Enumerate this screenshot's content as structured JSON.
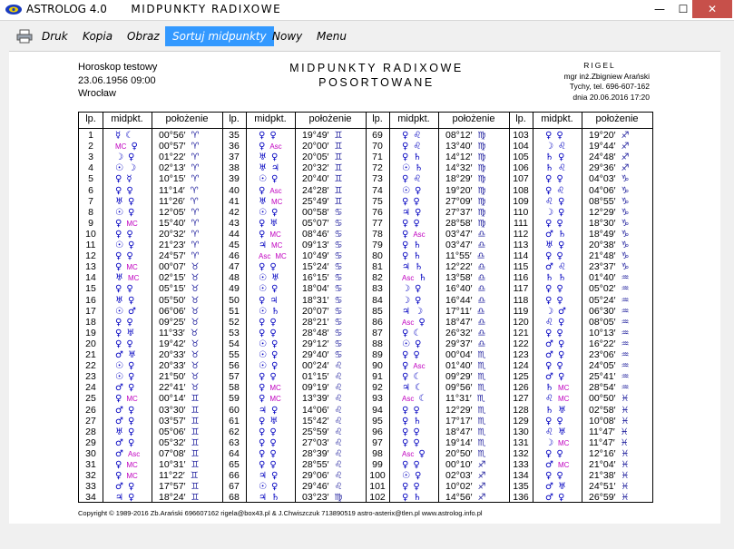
{
  "window": {
    "app_name": "ASTROLOG 4.0",
    "doc_title": "MIDPUNKTY RADIXOWE",
    "min": "—",
    "max": "☐",
    "close": "✕"
  },
  "menu": {
    "items": [
      "Druk",
      "Kopia",
      "Obraz",
      "Sortuj midpunkty",
      "Nowy",
      "Menu"
    ],
    "active": "Sortuj midpunkty"
  },
  "header": {
    "left": [
      "Horoskop testowy",
      "23.06.1956  09:00",
      "Wrocław"
    ],
    "center": [
      "MIDPUNKTY RADIXOWE",
      "POSORTOWANE"
    ],
    "right_company": "RIGEL",
    "right_lines": [
      "mgr inż.Zbigniew Arański",
      "Tychy, tel. 696-607-162",
      "dnia 20.06.2016 17:20"
    ]
  },
  "table": {
    "headers": [
      "lp.",
      "midpkt.",
      "położenie"
    ],
    "row_count": 34,
    "rows": [
      {
        "n": 1,
        "a": "☿",
        "b": "☾",
        "d": "00°56′",
        "s": "♈"
      },
      {
        "n": 2,
        "a": "MC",
        "b": "♀",
        "d": "00°57′",
        "s": "♈"
      },
      {
        "n": 3,
        "a": "☽",
        "b": "♀",
        "d": "01°22′",
        "s": "♈"
      },
      {
        "n": 4,
        "a": "☉",
        "b": "☽",
        "d": "02°13′",
        "s": "♈"
      },
      {
        "n": 5,
        "a": "♀",
        "b": "☿",
        "d": "10°15′",
        "s": "♈"
      },
      {
        "n": 6,
        "a": "♀",
        "b": "♀",
        "d": "11°14′",
        "s": "♈"
      },
      {
        "n": 7,
        "a": "♅",
        "b": "♀",
        "d": "11°26′",
        "s": "♈"
      },
      {
        "n": 8,
        "a": "☉",
        "b": "♀",
        "d": "12°05′",
        "s": "♈"
      },
      {
        "n": 9,
        "a": "♀",
        "b": "MC",
        "d": "15°40′",
        "s": "♈"
      },
      {
        "n": 10,
        "a": "♀",
        "b": "♀",
        "d": "20°32′",
        "s": "♈"
      },
      {
        "n": 11,
        "a": "☉",
        "b": "♀",
        "d": "21°23′",
        "s": "♈"
      },
      {
        "n": 12,
        "a": "♀",
        "b": "♀",
        "d": "24°57′",
        "s": "♈"
      },
      {
        "n": 13,
        "a": "♀",
        "b": "MC",
        "d": "00°07′",
        "s": "♉"
      },
      {
        "n": 14,
        "a": "♅",
        "b": "MC",
        "d": "02°15′",
        "s": "♉"
      },
      {
        "n": 15,
        "a": "♀",
        "b": "♀",
        "d": "05°15′",
        "s": "♉"
      },
      {
        "n": 16,
        "a": "♅",
        "b": "♀",
        "d": "05°50′",
        "s": "♉"
      },
      {
        "n": 17,
        "a": "☉",
        "b": "♂",
        "d": "06°06′",
        "s": "♉"
      },
      {
        "n": 18,
        "a": "♀",
        "b": "♀",
        "d": "09°25′",
        "s": "♉"
      },
      {
        "n": 19,
        "a": "♀",
        "b": "♅",
        "d": "11°33′",
        "s": "♉"
      },
      {
        "n": 20,
        "a": "♀",
        "b": "♀",
        "d": "19°42′",
        "s": "♉"
      },
      {
        "n": 21,
        "a": "♂",
        "b": "♅",
        "d": "20°33′",
        "s": "♉"
      },
      {
        "n": 22,
        "a": "☉",
        "b": "♀",
        "d": "20°33′",
        "s": "♉"
      },
      {
        "n": 23,
        "a": "☉",
        "b": "♀",
        "d": "21°50′",
        "s": "♉"
      },
      {
        "n": 24,
        "a": "♂",
        "b": "♀",
        "d": "22°41′",
        "s": "♉"
      },
      {
        "n": 25,
        "a": "♀",
        "b": "MC",
        "d": "00°14′",
        "s": "♊"
      },
      {
        "n": 26,
        "a": "♂",
        "b": "♀",
        "d": "03°30′",
        "s": "♊"
      },
      {
        "n": 27,
        "a": "♂",
        "b": "♀",
        "d": "03°57′",
        "s": "♊"
      },
      {
        "n": 28,
        "a": "♅",
        "b": "♀",
        "d": "05°06′",
        "s": "♊"
      },
      {
        "n": 29,
        "a": "♂",
        "b": "♀",
        "d": "05°32′",
        "s": "♊"
      },
      {
        "n": 30,
        "a": "♂",
        "b": "Asc",
        "d": "07°08′",
        "s": "♊"
      },
      {
        "n": 31,
        "a": "♀",
        "b": "MC",
        "d": "10°31′",
        "s": "♊"
      },
      {
        "n": 32,
        "a": "♀",
        "b": "MC",
        "d": "11°22′",
        "s": "♊"
      },
      {
        "n": 33,
        "a": "♂",
        "b": "♀",
        "d": "17°57′",
        "s": "♊"
      },
      {
        "n": 34,
        "a": "♃",
        "b": "♀",
        "d": "18°24′",
        "s": "♊"
      },
      {
        "n": 35,
        "a": "♀",
        "b": "♀",
        "d": "19°49′",
        "s": "♊"
      },
      {
        "n": 36,
        "a": "♀",
        "b": "Asc",
        "d": "20°00′",
        "s": "♊"
      },
      {
        "n": 37,
        "a": "♅",
        "b": "♀",
        "d": "20°05′",
        "s": "♊"
      },
      {
        "n": 38,
        "a": "♅",
        "b": "♃",
        "d": "20°32′",
        "s": "♊"
      },
      {
        "n": 39,
        "a": "☉",
        "b": "♀",
        "d": "20°40′",
        "s": "♊"
      },
      {
        "n": 40,
        "a": "♀",
        "b": "Asc",
        "d": "24°28′",
        "s": "♊"
      },
      {
        "n": 41,
        "a": "♅",
        "b": "MC",
        "d": "25°49′",
        "s": "♊"
      },
      {
        "n": 42,
        "a": "☉",
        "b": "♀",
        "d": "00°58′",
        "s": "♋"
      },
      {
        "n": 43,
        "a": "♀",
        "b": "♅",
        "d": "05°07′",
        "s": "♋"
      },
      {
        "n": 44,
        "a": "♀",
        "b": "MC",
        "d": "08°46′",
        "s": "♋"
      },
      {
        "n": 45,
        "a": "♃",
        "b": "MC",
        "d": "09°13′",
        "s": "♋"
      },
      {
        "n": 46,
        "a": "Asc",
        "b": "MC",
        "d": "10°49′",
        "s": "♋"
      },
      {
        "n": 47,
        "a": "♀",
        "b": "♀",
        "d": "15°24′",
        "s": "♋"
      },
      {
        "n": 48,
        "a": "☉",
        "b": "♅",
        "d": "16°15′",
        "s": "♋"
      },
      {
        "n": 49,
        "a": "☉",
        "b": "♀",
        "d": "18°04′",
        "s": "♋"
      },
      {
        "n": 50,
        "a": "♀",
        "b": "♃",
        "d": "18°31′",
        "s": "♋"
      },
      {
        "n": 51,
        "a": "☉",
        "b": "♄",
        "d": "20°07′",
        "s": "♋"
      },
      {
        "n": 52,
        "a": "♀",
        "b": "♀",
        "d": "28°21′",
        "s": "♋"
      },
      {
        "n": 53,
        "a": "♀",
        "b": "♀",
        "d": "28°48′",
        "s": "♋"
      },
      {
        "n": 54,
        "a": "☉",
        "b": "♀",
        "d": "29°12′",
        "s": "♋"
      },
      {
        "n": 55,
        "a": "☉",
        "b": "♀",
        "d": "29°40′",
        "s": "♋"
      },
      {
        "n": 56,
        "a": "☉",
        "b": "♀",
        "d": "00°24′",
        "s": "♌"
      },
      {
        "n": 57,
        "a": "♀",
        "b": "♀",
        "d": "01°15′",
        "s": "♌"
      },
      {
        "n": 58,
        "a": "♀",
        "b": "MC",
        "d": "09°19′",
        "s": "♌"
      },
      {
        "n": 59,
        "a": "♀",
        "b": "MC",
        "d": "13°39′",
        "s": "♌"
      },
      {
        "n": 60,
        "a": "♃",
        "b": "♀",
        "d": "14°06′",
        "s": "♌"
      },
      {
        "n": 61,
        "a": "♀",
        "b": "♅",
        "d": "15°42′",
        "s": "♌"
      },
      {
        "n": 62,
        "a": "♀",
        "b": "♀",
        "d": "25°59′",
        "s": "♌"
      },
      {
        "n": 63,
        "a": "♀",
        "b": "♀",
        "d": "27°03′",
        "s": "♌"
      },
      {
        "n": 64,
        "a": "♀",
        "b": "♀",
        "d": "28°39′",
        "s": "♌"
      },
      {
        "n": 65,
        "a": "♀",
        "b": "♀",
        "d": "28°55′",
        "s": "♌"
      },
      {
        "n": 66,
        "a": "♃",
        "b": "♀",
        "d": "29°06′",
        "s": "♌"
      },
      {
        "n": 67,
        "a": "☉",
        "b": "♀",
        "d": "29°46′",
        "s": "♌"
      },
      {
        "n": 68,
        "a": "♃",
        "b": "♄",
        "d": "03°23′",
        "s": "♍"
      },
      {
        "n": 69,
        "a": "♀",
        "b": "♌",
        "d": "08°12′",
        "s": "♍"
      },
      {
        "n": 70,
        "a": "♀",
        "b": "♌",
        "d": "13°40′",
        "s": "♍"
      },
      {
        "n": 71,
        "a": "♀",
        "b": "♄",
        "d": "14°12′",
        "s": "♍"
      },
      {
        "n": 72,
        "a": "☉",
        "b": "♄",
        "d": "14°32′",
        "s": "♍"
      },
      {
        "n": 73,
        "a": "♀",
        "b": "♌",
        "d": "18°29′",
        "s": "♍"
      },
      {
        "n": 74,
        "a": "☉",
        "b": "♀",
        "d": "19°20′",
        "s": "♍"
      },
      {
        "n": 75,
        "a": "♀",
        "b": "♀",
        "d": "27°09′",
        "s": "♍"
      },
      {
        "n": 76,
        "a": "♃",
        "b": "♀",
        "d": "27°37′",
        "s": "♍"
      },
      {
        "n": 77,
        "a": "♀",
        "b": "♀",
        "d": "28°58′",
        "s": "♍"
      },
      {
        "n": 78,
        "a": "♀",
        "b": "Asc",
        "d": "03°47′",
        "s": "♎"
      },
      {
        "n": 79,
        "a": "♀",
        "b": "♄",
        "d": "03°47′",
        "s": "♎"
      },
      {
        "n": 80,
        "a": "♀",
        "b": "♄",
        "d": "11°55′",
        "s": "♎"
      },
      {
        "n": 81,
        "a": "♃",
        "b": "♄",
        "d": "12°22′",
        "s": "♎"
      },
      {
        "n": 82,
        "a": "Asc",
        "b": "♄",
        "d": "13°58′",
        "s": "♎"
      },
      {
        "n": 83,
        "a": "☽",
        "b": "♀",
        "d": "16°40′",
        "s": "♎"
      },
      {
        "n": 84,
        "a": "☽",
        "b": "♀",
        "d": "16°44′",
        "s": "♎"
      },
      {
        "n": 85,
        "a": "♃",
        "b": "☽",
        "d": "17°11′",
        "s": "♎"
      },
      {
        "n": 86,
        "a": "Asc",
        "b": "♀",
        "d": "18°47′",
        "s": "♎"
      },
      {
        "n": 87,
        "a": "♀",
        "b": "☾",
        "d": "26°32′",
        "s": "♎"
      },
      {
        "n": 88,
        "a": "☉",
        "b": "♀",
        "d": "29°37′",
        "s": "♎"
      },
      {
        "n": 89,
        "a": "♀",
        "b": "♀",
        "d": "00°04′",
        "s": "♏"
      },
      {
        "n": 90,
        "a": "♀",
        "b": "Asc",
        "d": "01°40′",
        "s": "♏"
      },
      {
        "n": 91,
        "a": "♀",
        "b": "☾",
        "d": "09°29′",
        "s": "♏"
      },
      {
        "n": 92,
        "a": "♃",
        "b": "☾",
        "d": "09°56′",
        "s": "♏"
      },
      {
        "n": 93,
        "a": "Asc",
        "b": "☾",
        "d": "11°31′",
        "s": "♏"
      },
      {
        "n": 94,
        "a": "♀",
        "b": "♀",
        "d": "12°29′",
        "s": "♏"
      },
      {
        "n": 95,
        "a": "♀",
        "b": "♄",
        "d": "17°17′",
        "s": "♏"
      },
      {
        "n": 96,
        "a": "♀",
        "b": "♀",
        "d": "18°47′",
        "s": "♏"
      },
      {
        "n": 97,
        "a": "♀",
        "b": "♀",
        "d": "19°14′",
        "s": "♏"
      },
      {
        "n": 98,
        "a": "Asc",
        "b": "♀",
        "d": "20°50′",
        "s": "♏"
      },
      {
        "n": 99,
        "a": "♀",
        "b": "♀",
        "d": "00°10′",
        "s": "♐"
      },
      {
        "n": 100,
        "a": "☉",
        "b": "♀",
        "d": "02°03′",
        "s": "♐"
      },
      {
        "n": 101,
        "a": "♀",
        "b": "♀",
        "d": "10°02′",
        "s": "♐"
      },
      {
        "n": 102,
        "a": "♀",
        "b": "♄",
        "d": "14°56′",
        "s": "♐"
      },
      {
        "n": 103,
        "a": "♀",
        "b": "♀",
        "d": "19°20′",
        "s": "♐"
      },
      {
        "n": 104,
        "a": "☽",
        "b": "♌",
        "d": "19°44′",
        "s": "♐"
      },
      {
        "n": 105,
        "a": "♄",
        "b": "♀",
        "d": "24°48′",
        "s": "♐"
      },
      {
        "n": 106,
        "a": "♄",
        "b": "♌",
        "d": "29°36′",
        "s": "♐"
      },
      {
        "n": 107,
        "a": "♀",
        "b": "♀",
        "d": "04°03′",
        "s": "♑"
      },
      {
        "n": 108,
        "a": "♀",
        "b": "♌",
        "d": "04°06′",
        "s": "♑"
      },
      {
        "n": 109,
        "a": "♌",
        "b": "♀",
        "d": "08°55′",
        "s": "♑"
      },
      {
        "n": 110,
        "a": "☽",
        "b": "♀",
        "d": "12°29′",
        "s": "♑"
      },
      {
        "n": 111,
        "a": "♀",
        "b": "♀",
        "d": "18°30′",
        "s": "♑"
      },
      {
        "n": 112,
        "a": "♂",
        "b": "♄",
        "d": "18°49′",
        "s": "♑"
      },
      {
        "n": 113,
        "a": "♅",
        "b": "♀",
        "d": "20°38′",
        "s": "♑"
      },
      {
        "n": 114,
        "a": "♀",
        "b": "♀",
        "d": "21°48′",
        "s": "♑"
      },
      {
        "n": 115,
        "a": "♂",
        "b": "♌",
        "d": "23°37′",
        "s": "♑"
      },
      {
        "n": 116,
        "a": "♄",
        "b": "♄",
        "d": "01°40′",
        "s": "♒"
      },
      {
        "n": 117,
        "a": "♀",
        "b": "♀",
        "d": "05°02′",
        "s": "♒"
      },
      {
        "n": 118,
        "a": "♀",
        "b": "♀",
        "d": "05°24′",
        "s": "♒"
      },
      {
        "n": 119,
        "a": "☽",
        "b": "♂",
        "d": "06°30′",
        "s": "♒"
      },
      {
        "n": 120,
        "a": "♌",
        "b": "♀",
        "d": "08°05′",
        "s": "♒"
      },
      {
        "n": 121,
        "a": "♀",
        "b": "♀",
        "d": "10°13′",
        "s": "♒"
      },
      {
        "n": 122,
        "a": "♂",
        "b": "♀",
        "d": "16°22′",
        "s": "♒"
      },
      {
        "n": 123,
        "a": "♂",
        "b": "♀",
        "d": "23°06′",
        "s": "♒"
      },
      {
        "n": 124,
        "a": "♀",
        "b": "♀",
        "d": "24°05′",
        "s": "♒"
      },
      {
        "n": 125,
        "a": "♂",
        "b": "♀",
        "d": "25°41′",
        "s": "♒"
      },
      {
        "n": 126,
        "a": "♄",
        "b": "MC",
        "d": "28°54′",
        "s": "♒"
      },
      {
        "n": 127,
        "a": "♌",
        "b": "MC",
        "d": "00°50′",
        "s": "♓"
      },
      {
        "n": 128,
        "a": "♄",
        "b": "♅",
        "d": "02°58′",
        "s": "♓"
      },
      {
        "n": 129,
        "a": "♀",
        "b": "♀",
        "d": "10°08′",
        "s": "♓"
      },
      {
        "n": 130,
        "a": "♌",
        "b": "♅",
        "d": "11°47′",
        "s": "♓"
      },
      {
        "n": 131,
        "a": "☽",
        "b": "MC",
        "d": "11°47′",
        "s": "♓"
      },
      {
        "n": 132,
        "a": "♀",
        "b": "♀",
        "d": "12°16′",
        "s": "♓"
      },
      {
        "n": 133,
        "a": "♂",
        "b": "MC",
        "d": "21°04′",
        "s": "♓"
      },
      {
        "n": 134,
        "a": "♀",
        "b": "♀",
        "d": "21°38′",
        "s": "♓"
      },
      {
        "n": 135,
        "a": "♂",
        "b": "♅",
        "d": "24°51′",
        "s": "♓"
      },
      {
        "n": 136,
        "a": "♂",
        "b": "♀",
        "d": "26°59′",
        "s": "♓"
      }
    ]
  },
  "footer": "Copyright © 1989-2016 Zb.Arański 696607162 rigela@box43.pl & J.Chwiszczuk 713890519 astro-asterix@tlen.pl www.astrolog.info.pl"
}
